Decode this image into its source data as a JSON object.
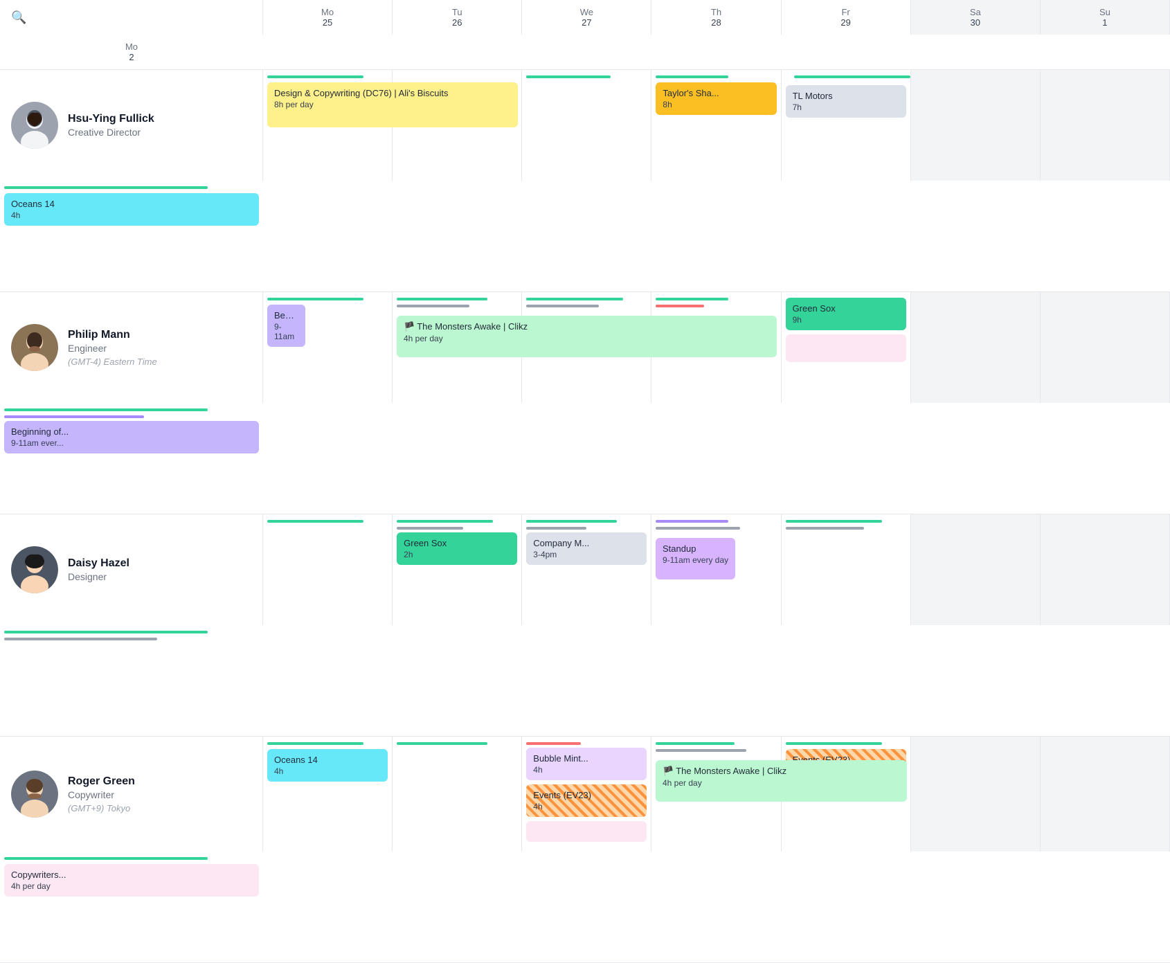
{
  "header": {
    "search_placeholder": "Search",
    "days": [
      {
        "name": "Mo",
        "num": "25"
      },
      {
        "name": "Tu",
        "num": "26"
      },
      {
        "name": "We",
        "num": "27"
      },
      {
        "name": "Th",
        "num": "28"
      },
      {
        "name": "Fr",
        "num": "29"
      },
      {
        "name": "Sa",
        "num": "30"
      },
      {
        "name": "Su",
        "num": "1"
      },
      {
        "name": "Mo",
        "num": "2"
      }
    ]
  },
  "people": [
    {
      "id": "hsu-ying",
      "name": "Hsu-Ying Fullick",
      "role": "Creative Director",
      "tz": null,
      "avatar_color": "#6b7280"
    },
    {
      "id": "philip",
      "name": "Philip Mann",
      "role": "Engineer",
      "tz": "(GMT-4) Eastern Time",
      "avatar_color": "#4b5563"
    },
    {
      "id": "daisy",
      "name": "Daisy Hazel",
      "role": "Designer",
      "tz": null,
      "avatar_color": "#1f2937"
    },
    {
      "id": "roger",
      "name": "Roger Green",
      "role": "Copywriter",
      "tz": "(GMT+9) Tokyo",
      "avatar_color": "#374151"
    }
  ],
  "labels": {
    "design_copywriting": "Design & Copywriting (DC76) | Ali's Biscuits",
    "design_copywriting_time": "8h per day",
    "taylors_sha": "Taylor's Sha...",
    "taylors_sha_time": "8h",
    "tl_motors": "TL Motors",
    "tl_motors_time": "7h",
    "oceans_14_1": "Oceans 14",
    "oceans_14_1_time": "4h",
    "beginning_of": "Beginning of...",
    "beginning_of_time": "9-11am",
    "monsters_awake": "The Monsters Awake | Clikz",
    "monsters_awake_time": "4h per day",
    "green_sox_1": "Green Sox",
    "green_sox_1_time": "9h",
    "beginning_of_2": "Beginning of...",
    "beginning_of_2_time": "9-11am ever...",
    "green_sox_2": "Green Sox",
    "green_sox_2_time": "2h",
    "company_m": "Company M...",
    "company_m_time": "3-4pm",
    "standup": "Standup",
    "standup_time": "9-11am every day",
    "oceans_14_2": "Oceans 14",
    "oceans_14_2_time": "4h",
    "bubble_mint": "Bubble Mint...",
    "bubble_mint_time": "4h",
    "monsters_awake_2": "The Monsters Awake | Clikz",
    "monsters_awake_2_time": "4h per day",
    "copywriters": "Copywriters...",
    "copywriters_time": "4h per day",
    "events_ev23_1": "Events (EV23)",
    "events_ev23_1_time": "4h",
    "events_ev23_2": "Events (EV23)",
    "events_ev23_2_time": "4h"
  }
}
